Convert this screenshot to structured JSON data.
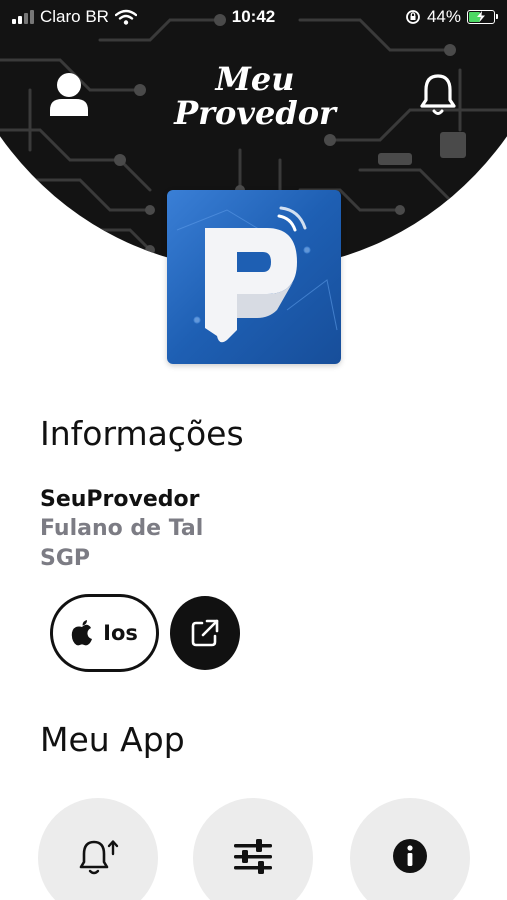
{
  "status_bar": {
    "carrier": "Claro BR",
    "time": "10:42",
    "battery_percent": "44%",
    "battery_level": 0.44,
    "icons": [
      "signal-icon",
      "wifi-icon",
      "orientation-lock-icon",
      "battery-charging-icon"
    ]
  },
  "header": {
    "brand_line1": "Meu",
    "brand_line2": "Provedor",
    "left_icon": "user-icon",
    "right_icon": "bell-icon"
  },
  "logo": {
    "icon": "provider-logo-icon",
    "colors": [
      "#3a7fd6",
      "#174e9a"
    ]
  },
  "info": {
    "title": "Informações",
    "provider": "SeuProvedor",
    "user_name": "Fulano de Tal",
    "system": "SGP",
    "platform_label": "Ios",
    "platform_icon": "apple-icon",
    "open_icon": "external-link-icon"
  },
  "my_app": {
    "title": "Meu App",
    "shortcuts": [
      {
        "icon": "notification-settings-icon"
      },
      {
        "icon": "sliders-icon"
      },
      {
        "icon": "info-icon"
      }
    ]
  },
  "colors": {
    "header_bg": "#131313",
    "accent_dark": "#111111",
    "muted_text": "#7c7c84",
    "shortcut_bg": "#ececec",
    "battery_green": "#4cd964"
  }
}
